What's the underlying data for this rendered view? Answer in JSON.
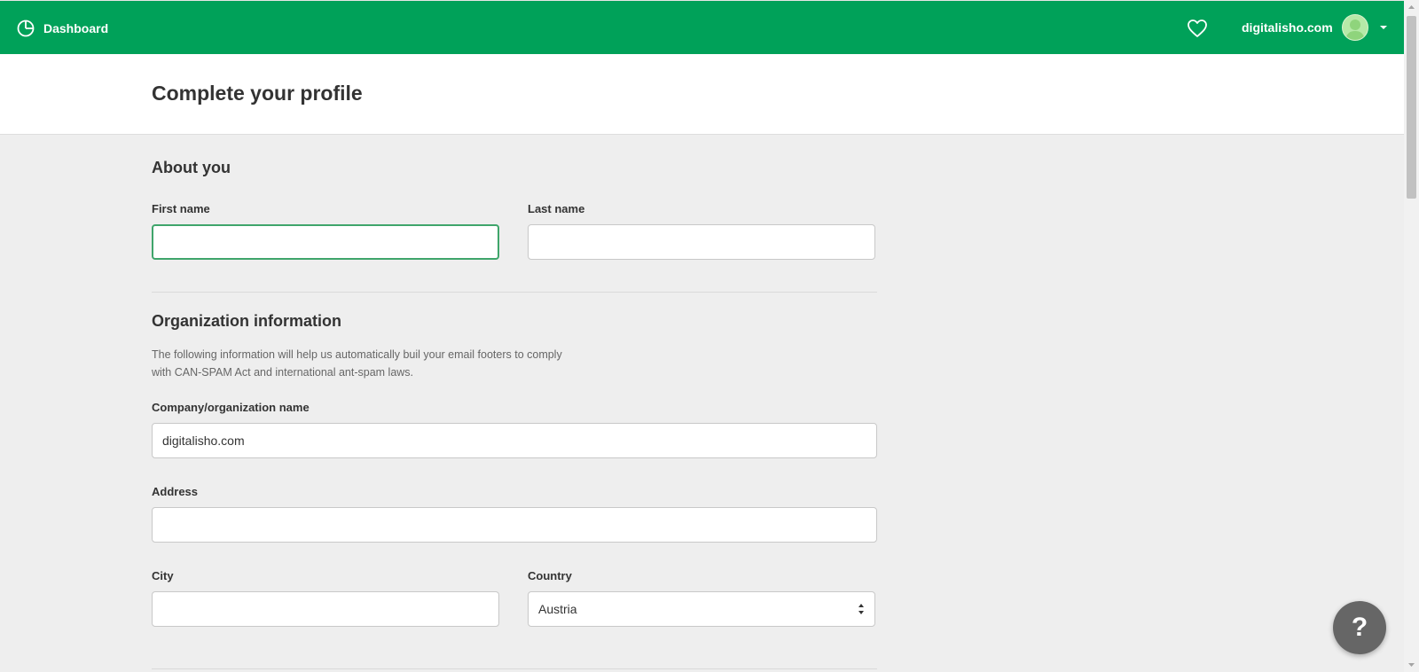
{
  "topbar": {
    "dashboard_label": "Dashboard",
    "account_name": "digitalisho.com",
    "bg_color": "#00a159"
  },
  "header": {
    "title": "Complete your profile"
  },
  "about": {
    "title": "About you",
    "first_name_label": "First name",
    "first_name_value": "",
    "last_name_label": "Last name",
    "last_name_value": ""
  },
  "org": {
    "title": "Organization information",
    "description_line1": "The following information will help us automatically buil your email footers to comply",
    "description_line2": "with CAN-SPAM Act and international ant-spam laws.",
    "company_label": "Company/organization name",
    "company_value": "digitalisho.com",
    "address_label": "Address",
    "address_value": "",
    "city_label": "City",
    "city_value": "",
    "country_label": "Country",
    "country_value": "Austria"
  },
  "help": {
    "label": "?"
  },
  "icons": {
    "dashboard": "pie-chart-icon",
    "favorites": "heart-icon",
    "account_menu": "caret-down-icon",
    "select": "select-arrows-icon"
  }
}
